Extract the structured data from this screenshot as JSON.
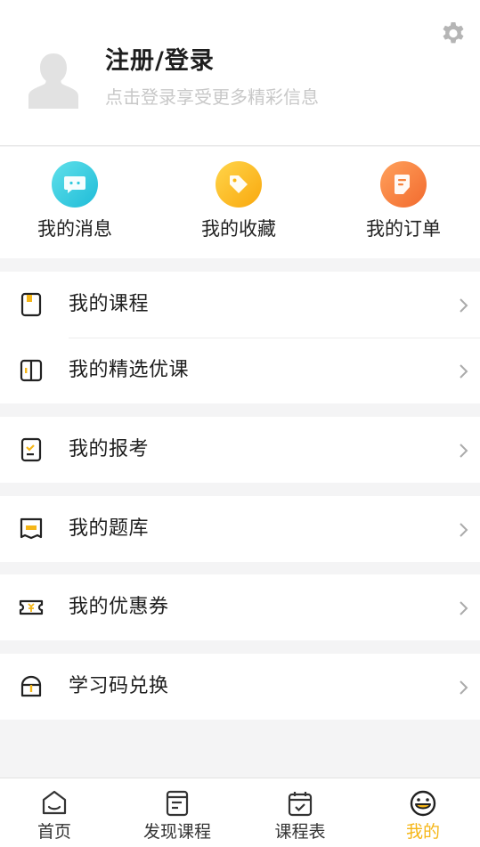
{
  "header": {
    "title": "注册/登录",
    "subtitle": "点击登录享受更多精彩信息",
    "settings_icon": "gear-icon",
    "avatar_icon": "default-avatar-icon"
  },
  "quick_actions": [
    {
      "label": "我的消息",
      "icon": "message-icon",
      "color": "#2ec9de"
    },
    {
      "label": "我的收藏",
      "icon": "tag-icon",
      "color": "#fbb715"
    },
    {
      "label": "我的订单",
      "icon": "order-icon",
      "color": "#f6813c"
    }
  ],
  "menu": {
    "group1": [
      {
        "label": "我的课程",
        "icon": "book-icon"
      },
      {
        "label": "我的精选优课",
        "icon": "open-book-icon"
      }
    ],
    "group2": [
      {
        "label": "我的报考",
        "icon": "checklist-icon"
      }
    ],
    "group3": [
      {
        "label": "我的题库",
        "icon": "question-bank-icon"
      }
    ],
    "group4": [
      {
        "label": "我的优惠券",
        "icon": "coupon-icon"
      }
    ],
    "group5": [
      {
        "label": "学习码兑换",
        "icon": "redeem-bag-icon"
      }
    ]
  },
  "tabbar": [
    {
      "label": "首页",
      "icon": "home-icon",
      "active": false
    },
    {
      "label": "发现课程",
      "icon": "discover-icon",
      "active": false
    },
    {
      "label": "课程表",
      "icon": "calendar-icon",
      "active": false
    },
    {
      "label": "我的",
      "icon": "smile-icon",
      "active": true
    }
  ],
  "colors": {
    "accent": "#f5b617",
    "icon_yellow": "#f5b617",
    "text": "#1e1e1e",
    "muted": "#c8c8c8"
  }
}
